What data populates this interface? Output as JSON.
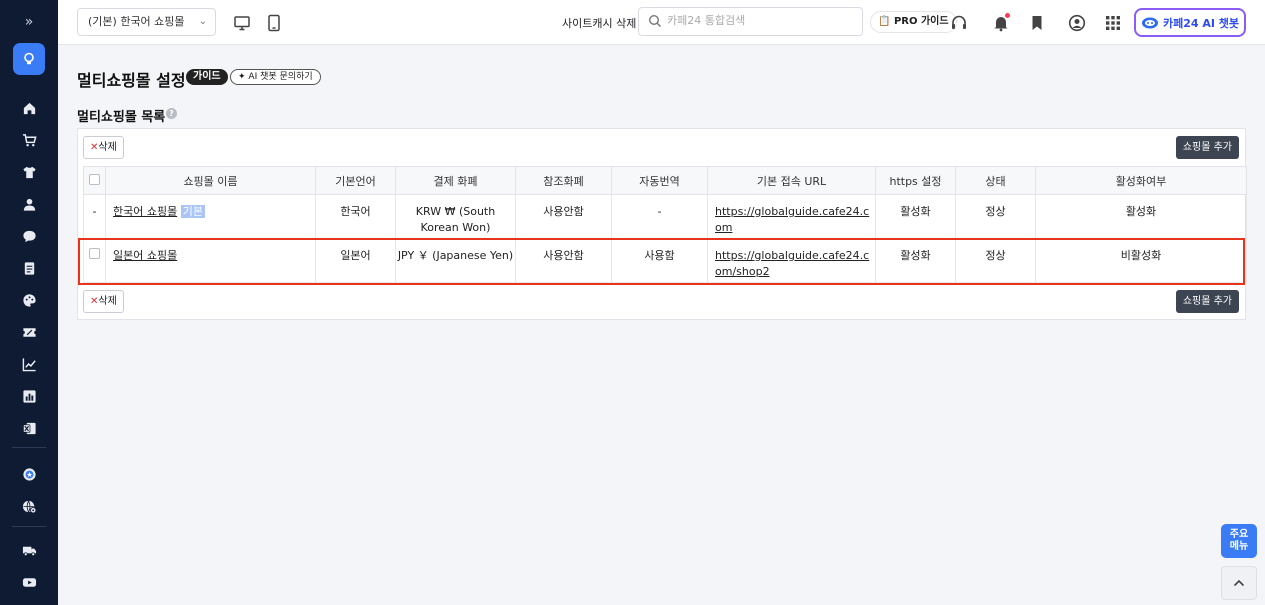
{
  "header": {
    "shop_select": "(기본) 한국어 쇼핑몰",
    "cache_delete": "사이트캐시 삭제",
    "search_placeholder": "카페24 통합검색",
    "pro_guide": "PRO 가이드",
    "ai_chatbot": "카페24 AI 챗봇"
  },
  "page": {
    "title": "멀티쇼핑몰 설정",
    "guide_badge": "가이드",
    "ai_ask": "AI 챗봇 문의하기",
    "section_title": "멀티쇼핑몰 목록"
  },
  "toolbar": {
    "delete_label": "삭제",
    "add_label": "쇼핑몰 추가"
  },
  "table": {
    "columns": [
      "쇼핑몰 이름",
      "기본언어",
      "결제 화폐",
      "참조화폐",
      "자동번역",
      "기본 접속 URL",
      "https 설정",
      "상태",
      "활성화여부"
    ],
    "rows": [
      {
        "select": "-",
        "name": "한국어 쇼핑몰",
        "tag": "기본",
        "language": "한국어",
        "currency": "KRW ₩ (South Korean Won)",
        "ref_currency": "사용안함",
        "auto_translate": "-",
        "url": "https://globalguide.cafe24.com",
        "https": "활성화",
        "status": "정상",
        "active": "활성화"
      },
      {
        "select": "",
        "name": "일본어 쇼핑몰",
        "tag": "",
        "language": "일본어",
        "currency": "JPY ￥ (Japanese Yen)",
        "ref_currency": "사용안함",
        "auto_translate": "사용함",
        "url": "https://globalguide.cafe24.com/shop2",
        "https": "활성화",
        "status": "정상",
        "active": "비활성화"
      }
    ]
  },
  "floating": {
    "quick_menu_line1": "주요",
    "quick_menu_line2": "메뉴"
  },
  "colors": {
    "sidebar_bg": "#0f1b33",
    "accent": "#3a7bf6",
    "highlight_border": "#e8341c",
    "ai_border": "#8b5cf6"
  }
}
